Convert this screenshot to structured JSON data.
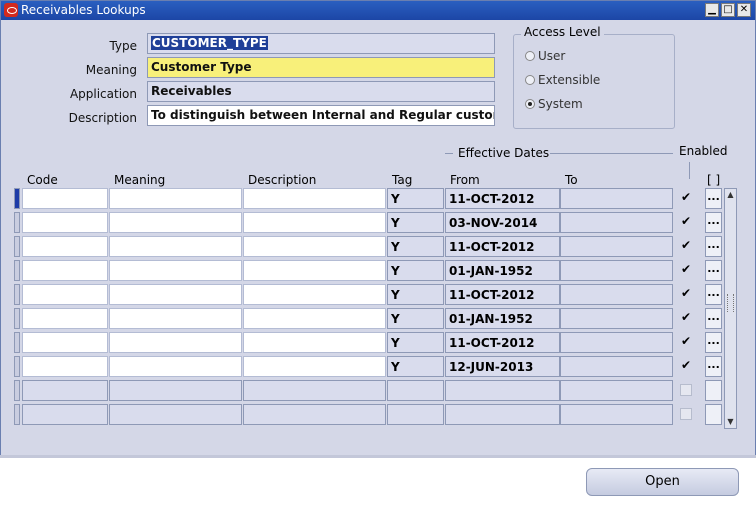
{
  "window": {
    "title": "Receivables Lookups"
  },
  "titlebar_buttons": {
    "min": "▁",
    "max": "□",
    "close": "✕"
  },
  "form": {
    "type_label": "Type",
    "type_value": "CUSTOMER_TYPE",
    "meaning_label": "Meaning",
    "meaning_value": "Customer Type",
    "application_label": "Application",
    "application_value": "Receivables",
    "description_label": "Description",
    "description_value": "To distinguish between Internal and Regular customers"
  },
  "access_level": {
    "title": "Access Level",
    "options": [
      {
        "label": "User",
        "selected": false
      },
      {
        "label": "Extensible",
        "selected": false
      },
      {
        "label": "System",
        "selected": true
      }
    ]
  },
  "grid": {
    "effective_dates_label": "Effective Dates",
    "enabled_label": "Enabled",
    "dfield_label": "[ ]",
    "headers": {
      "code": "Code",
      "meaning": "Meaning",
      "description": "Description",
      "tag": "Tag",
      "from": "From",
      "to": "To"
    },
    "rows": [
      {
        "code": "",
        "meaning": "",
        "description": "",
        "tag": "Y",
        "from": "11-OCT-2012",
        "to": "",
        "enabled": true
      },
      {
        "code": "",
        "meaning": "",
        "description": "",
        "tag": "Y",
        "from": "03-NOV-2014",
        "to": "",
        "enabled": true
      },
      {
        "code": "",
        "meaning": "",
        "description": "",
        "tag": "Y",
        "from": "11-OCT-2012",
        "to": "",
        "enabled": true
      },
      {
        "code": "",
        "meaning": "",
        "description": "",
        "tag": "Y",
        "from": "01-JAN-1952",
        "to": "",
        "enabled": true
      },
      {
        "code": "",
        "meaning": "",
        "description": "",
        "tag": "Y",
        "from": "11-OCT-2012",
        "to": "",
        "enabled": true
      },
      {
        "code": "",
        "meaning": "",
        "description": "",
        "tag": "Y",
        "from": "01-JAN-1952",
        "to": "",
        "enabled": true
      },
      {
        "code": "",
        "meaning": "",
        "description": "",
        "tag": "Y",
        "from": "11-OCT-2012",
        "to": "",
        "enabled": true
      },
      {
        "code": "",
        "meaning": "",
        "description": "",
        "tag": "Y",
        "from": "12-JUN-2013",
        "to": "",
        "enabled": true
      },
      {
        "code": "",
        "meaning": "",
        "description": "",
        "tag": "",
        "from": "",
        "to": "",
        "enabled": false
      },
      {
        "code": "",
        "meaning": "",
        "description": "",
        "tag": "",
        "from": "",
        "to": "",
        "enabled": false
      }
    ],
    "dots_label": "..."
  },
  "buttons": {
    "open_label": "Open"
  }
}
